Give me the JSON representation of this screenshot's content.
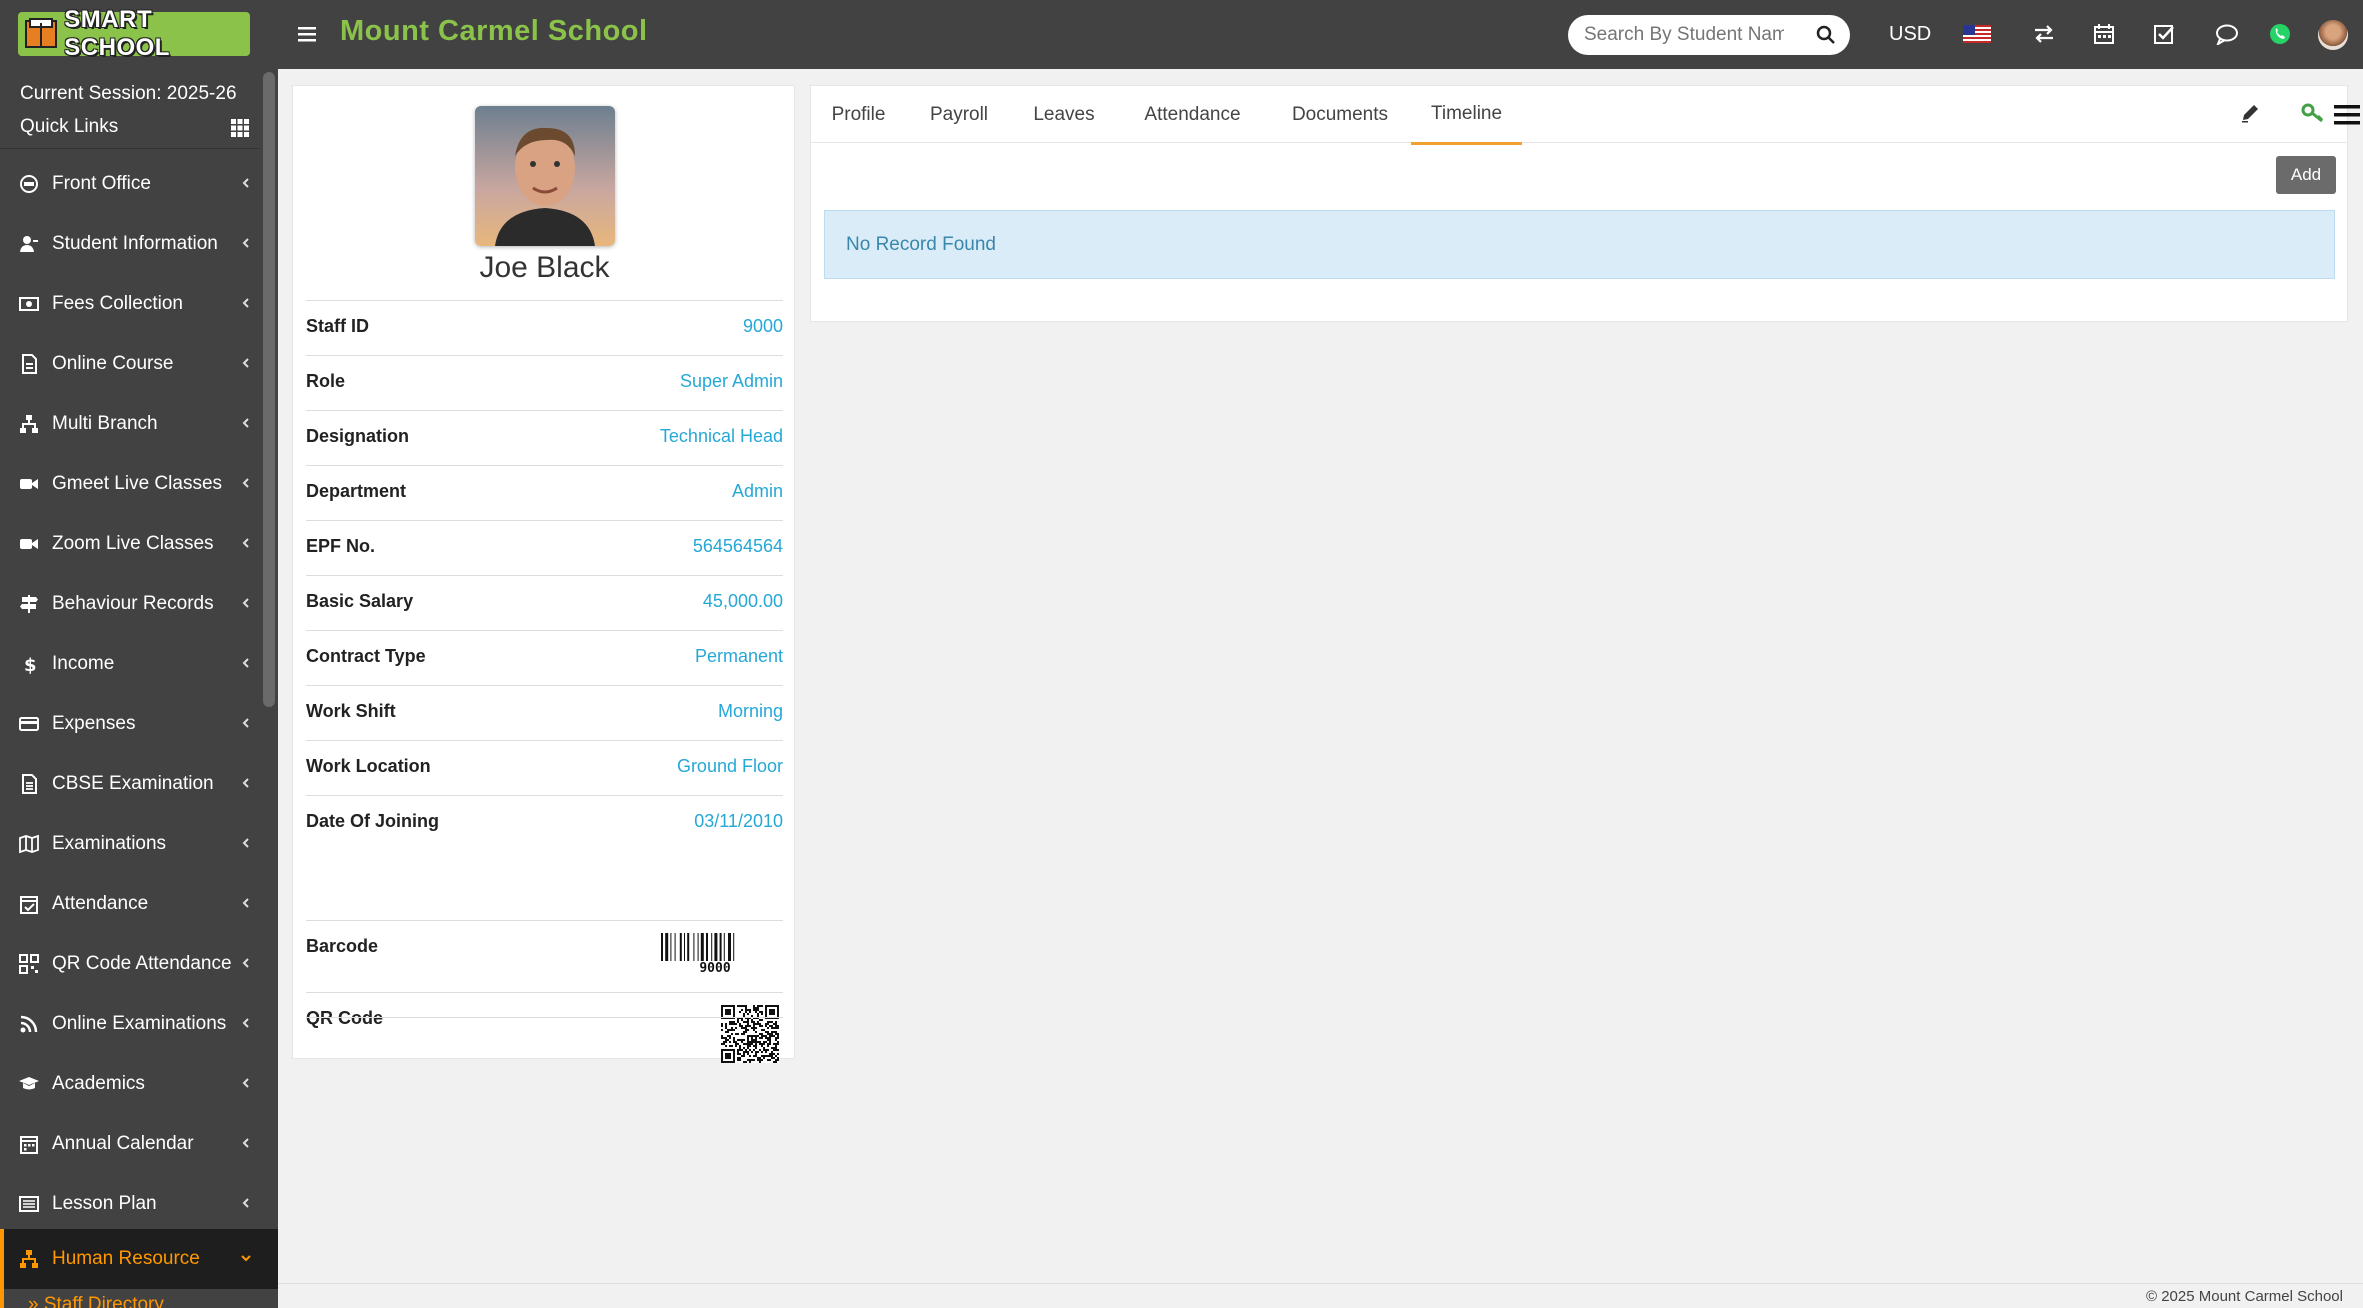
{
  "header": {
    "logo_text": "SMART SCHOOL",
    "school_name": "Mount Carmel School",
    "search_placeholder": "Search By Student Name",
    "currency": "USD"
  },
  "sidebar": {
    "session": "Current Session: 2025-26",
    "quick_links": "Quick Links",
    "items": [
      {
        "label": "Front Office",
        "icon": "front-office-icon"
      },
      {
        "label": "Student Information",
        "icon": "student-icon"
      },
      {
        "label": "Fees Collection",
        "icon": "money-icon"
      },
      {
        "label": "Online Course",
        "icon": "course-icon"
      },
      {
        "label": "Multi Branch",
        "icon": "branch-icon"
      },
      {
        "label": "Gmeet Live Classes",
        "icon": "video-icon"
      },
      {
        "label": "Zoom Live Classes",
        "icon": "video-icon"
      },
      {
        "label": "Behaviour Records",
        "icon": "signpost-icon"
      },
      {
        "label": "Income",
        "icon": "dollar-icon"
      },
      {
        "label": "Expenses",
        "icon": "credit-card-icon"
      },
      {
        "label": "CBSE Examination",
        "icon": "document-icon"
      },
      {
        "label": "Examinations",
        "icon": "map-icon"
      },
      {
        "label": "Attendance",
        "icon": "calendar-check-icon"
      },
      {
        "label": "QR Code Attendance",
        "icon": "qrcode-icon"
      },
      {
        "label": "Online Examinations",
        "icon": "rss-icon"
      },
      {
        "label": "Academics",
        "icon": "graduation-cap-icon"
      },
      {
        "label": "Annual Calendar",
        "icon": "calendar-icon"
      },
      {
        "label": "Lesson Plan",
        "icon": "list-icon"
      },
      {
        "label": "Human Resource",
        "icon": "sitemap-icon"
      }
    ],
    "sub_item": "» Staff Directory"
  },
  "profile": {
    "name": "Joe Black",
    "rows": [
      {
        "label": "Staff ID",
        "value": "9000"
      },
      {
        "label": "Role",
        "value": "Super Admin"
      },
      {
        "label": "Designation",
        "value": "Technical Head"
      },
      {
        "label": "Department",
        "value": "Admin"
      },
      {
        "label": "EPF No.",
        "value": "564564564"
      },
      {
        "label": "Basic Salary",
        "value": "45,000.00"
      },
      {
        "label": "Contract Type",
        "value": "Permanent"
      },
      {
        "label": "Work Shift",
        "value": "Morning"
      },
      {
        "label": "Work Location",
        "value": "Ground Floor"
      },
      {
        "label": "Date Of Joining",
        "value": "03/11/2010"
      }
    ],
    "barcode_label": "Barcode",
    "barcode_number": "9000",
    "qr_label": "QR Code"
  },
  "tabs": {
    "items": [
      "Profile",
      "Payroll",
      "Leaves",
      "Attendance",
      "Documents",
      "Timeline"
    ],
    "active": "Timeline",
    "add_label": "Add",
    "no_record": "No Record Found"
  },
  "footer": {
    "text": "© 2025 Mount Carmel School"
  },
  "colors": {
    "brand_green": "#8bc34a",
    "header_bg": "#424242",
    "accent_orange": "#ff9800",
    "link_blue": "#26a8d6"
  }
}
